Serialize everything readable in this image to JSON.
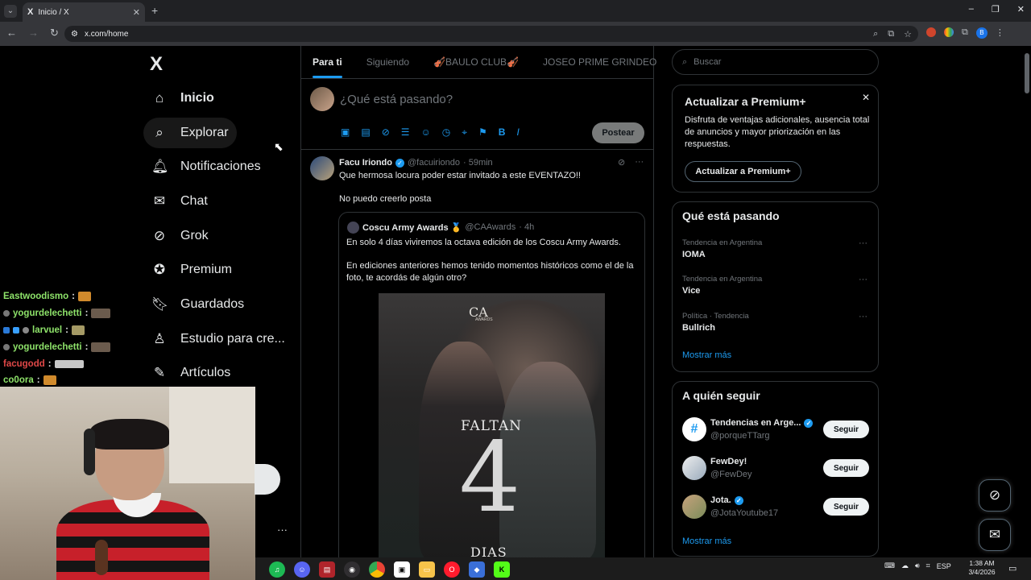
{
  "browser": {
    "tab_title": "Inicio / X",
    "tab_logo": "X",
    "tab_close": "✕",
    "new_tab": "+",
    "url": "x.com/home",
    "window_controls": [
      "–",
      "❐",
      "✕"
    ],
    "profile_initial": "B"
  },
  "nav": {
    "logo": "X",
    "items": [
      {
        "label": "Inicio",
        "icon": "home-icon"
      },
      {
        "label": "Explorar",
        "icon": "search-icon"
      },
      {
        "label": "Notificaciones",
        "icon": "bell-icon"
      },
      {
        "label": "Chat",
        "icon": "mail-icon"
      },
      {
        "label": "Grok",
        "icon": "grok-icon"
      },
      {
        "label": "Premium",
        "icon": "verified-icon"
      },
      {
        "label": "Guardados",
        "icon": "bookmark-icon"
      },
      {
        "label": "Estudio para cre...",
        "icon": "creator-studio-icon"
      },
      {
        "label": "Artículos",
        "icon": "articles-icon"
      }
    ]
  },
  "chat_overlay": [
    {
      "user": "Eastwoodismo",
      "color": "#8ee36a"
    },
    {
      "user": "yogurdelechetti",
      "color": "#8ee36a"
    },
    {
      "user": "larvuel",
      "color": "#8ee36a"
    },
    {
      "user": "yogurdelechetti",
      "color": "#8ee36a"
    },
    {
      "user": "facugodd",
      "color": "#e04848"
    },
    {
      "user": "co0ora",
      "color": "#8ee36a"
    }
  ],
  "feed": {
    "tabs": [
      {
        "label": "Para ti",
        "active": true
      },
      {
        "label": "Siguiendo",
        "active": false
      },
      {
        "label": "🎻BAULO CLUB🎻",
        "active": false
      },
      {
        "label": "JOSEO PRIME GRINDEO",
        "active": false
      }
    ],
    "composer_placeholder": "¿Qué está pasando?",
    "post_button": "Postear",
    "tweet": {
      "name": "Facu Iriondo",
      "handle": "@facuiriondo",
      "time": "· 59min",
      "text": "Que hermosa locura poder estar invitado a este EVENTAZO!!",
      "text2": "No puedo creerlo posta",
      "quote": {
        "name": "Coscu Army Awards 🥇",
        "handle": "@CAAwards",
        "time": "· 4h",
        "text1": "En solo 4 días viviremos la octava edición de los Coscu Army Awards.",
        "text2": "En ediciones anteriores hemos tenido momentos históricos como el de la foto, te acordás de algún otro?",
        "poster": {
          "logo": "CA",
          "sub": "AWARDS",
          "faltan": "FALTAN",
          "number": "4",
          "dias": "DIAS"
        }
      }
    }
  },
  "sidebar": {
    "search_placeholder": "Buscar",
    "premium": {
      "title": "Actualizar a Premium+",
      "desc": "Disfruta de ventajas adicionales, ausencia total de anuncios y mayor priorización en las respuestas.",
      "button": "Actualizar a Premium+"
    },
    "trends": {
      "title": "Qué está pasando",
      "items": [
        {
          "context": "Tendencia en Argentina",
          "name": "IOMA"
        },
        {
          "context": "Tendencia en Argentina",
          "name": "Vice"
        },
        {
          "context": "Política · Tendencia",
          "name": "Bullrich"
        }
      ],
      "more": "Mostrar más"
    },
    "follow": {
      "title": "A quién seguir",
      "items": [
        {
          "name": "Tendencias en Arge...",
          "handle": "@porqueTTarg",
          "button": "Seguir",
          "avatar": "#"
        },
        {
          "name": "FewDey!",
          "handle": "@FewDey",
          "button": "Seguir",
          "avatar": ""
        },
        {
          "name": "Jota.",
          "handle": "@JotaYoutube17",
          "button": "Seguir",
          "avatar": ""
        }
      ],
      "more": "Mostrar más"
    }
  },
  "taskbar": {
    "lang": "ESP",
    "time": "1:38 AM",
    "date": "3/4/2026"
  },
  "colors": {
    "accent": "#1d9bf0",
    "background": "#000000",
    "border": "#2f3336"
  }
}
